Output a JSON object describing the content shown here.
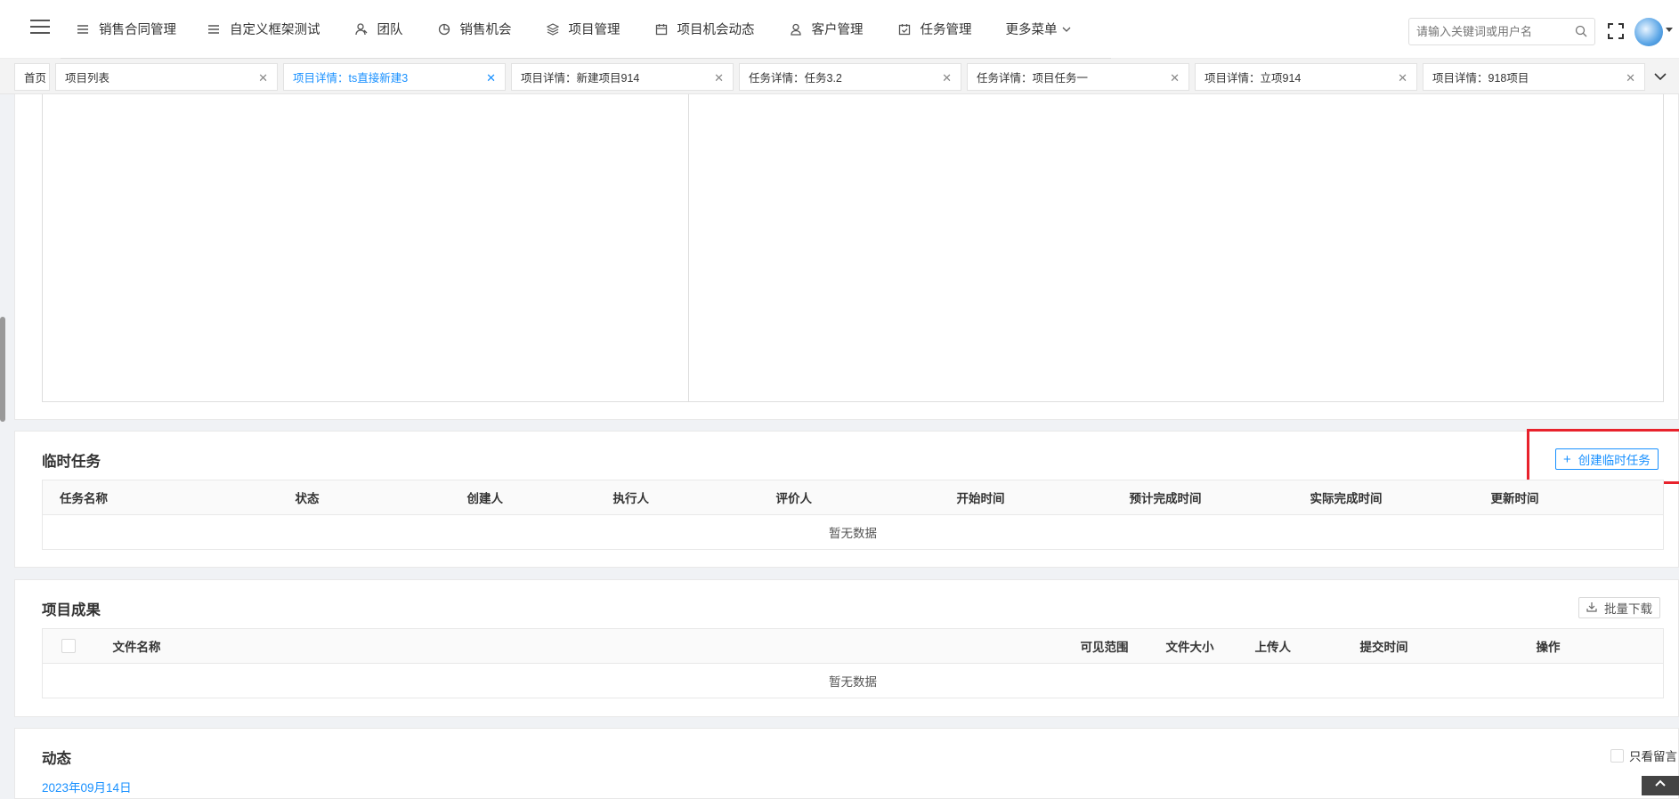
{
  "nav": {
    "items": [
      {
        "label": "销售合同管理",
        "icon": "list-icon"
      },
      {
        "label": "自定义框架测试",
        "icon": "list-icon"
      },
      {
        "label": "团队",
        "icon": "team-icon"
      },
      {
        "label": "销售机会",
        "icon": "pie-chart-icon"
      },
      {
        "label": "项目管理",
        "icon": "layers-icon"
      },
      {
        "label": "项目机会动态",
        "icon": "calendar-icon"
      },
      {
        "label": "客户管理",
        "icon": "user-icon"
      },
      {
        "label": "任务管理",
        "icon": "checkbox-calendar-icon"
      },
      {
        "label": "更多菜单",
        "icon": "chevron-down-icon"
      }
    ],
    "search_placeholder": "请输入关键词或用户名"
  },
  "tabs": [
    {
      "label": "首页",
      "closable": false,
      "active": false
    },
    {
      "label": "项目列表",
      "closable": true,
      "active": false
    },
    {
      "label": "项目详情：ts直接新建3",
      "closable": true,
      "active": true
    },
    {
      "label": "项目详情：新建项目914",
      "closable": true,
      "active": false
    },
    {
      "label": "任务详情：任务3.2",
      "closable": true,
      "active": false
    },
    {
      "label": "任务详情：项目任务一",
      "closable": true,
      "active": false
    },
    {
      "label": "项目详情：立项914",
      "closable": true,
      "active": false
    },
    {
      "label": "项目详情：918项目",
      "closable": true,
      "active": false
    }
  ],
  "temp_tasks": {
    "title": "临时任务",
    "create_button": "创建临时任务",
    "columns": [
      "任务名称",
      "状态",
      "创建人",
      "执行人",
      "评价人",
      "开始时间",
      "预计完成时间",
      "实际完成时间",
      "更新时间"
    ],
    "empty_text": "暂无数据"
  },
  "deliverables": {
    "title": "项目成果",
    "download_button": "批量下载",
    "columns": [
      "文件名称",
      "可见范围",
      "文件大小",
      "上传人",
      "提交时间",
      "操作"
    ],
    "empty_text": "暂无数据"
  },
  "activity": {
    "title": "动态",
    "only_messages_label": "只看留言",
    "date": "2023年09月14日"
  },
  "colors": {
    "accent": "#1890ff",
    "highlight": "#e8222c"
  }
}
